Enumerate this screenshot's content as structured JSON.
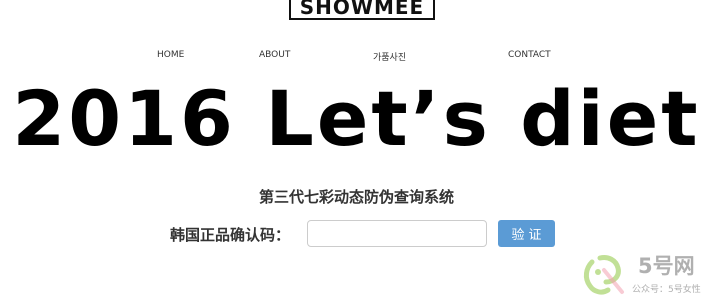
{
  "logo": {
    "text": "SHOWMEE"
  },
  "nav": {
    "items": [
      {
        "label": "HOME"
      },
      {
        "label": "ABOUT"
      },
      {
        "label": "가품사진"
      },
      {
        "label": "CONTACT"
      }
    ]
  },
  "hero": {
    "text": "2016 Let’s diet"
  },
  "verification": {
    "title": "第三代七彩动态防伪查询系统",
    "code_label": "韩国正品确认码：",
    "code_input_value": "",
    "code_input_placeholder": "",
    "submit_label": "验证",
    "button_color": "#5b9bd5"
  },
  "watermark": {
    "brand": "5号网",
    "subtitle": "公众号：5号女性",
    "logo_color": "#8ec63f"
  }
}
